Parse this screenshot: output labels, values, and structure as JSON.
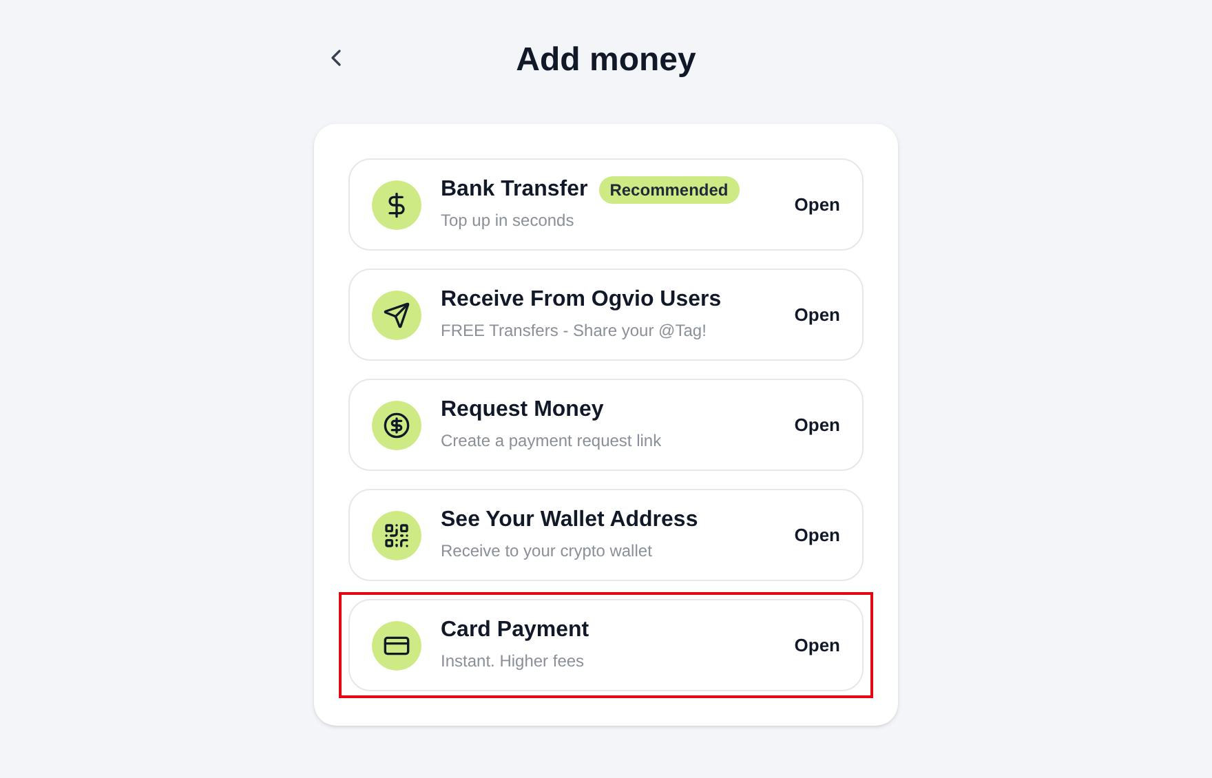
{
  "header": {
    "title": "Add money"
  },
  "options": [
    {
      "title": "Bank Transfer",
      "badge": "Recommended",
      "subtitle": "Top up in seconds",
      "action": "Open",
      "highlighted": false
    },
    {
      "title": "Receive From Ogvio Users",
      "subtitle": "FREE Transfers - Share your @Tag!",
      "action": "Open",
      "highlighted": false
    },
    {
      "title": "Request Money",
      "subtitle": "Create a payment request link",
      "action": "Open",
      "highlighted": false
    },
    {
      "title": "See Your Wallet Address",
      "subtitle": "Receive to your crypto wallet",
      "action": "Open",
      "highlighted": false
    },
    {
      "title": "Card Payment",
      "subtitle": "Instant. Higher fees",
      "action": "Open",
      "highlighted": true
    }
  ]
}
